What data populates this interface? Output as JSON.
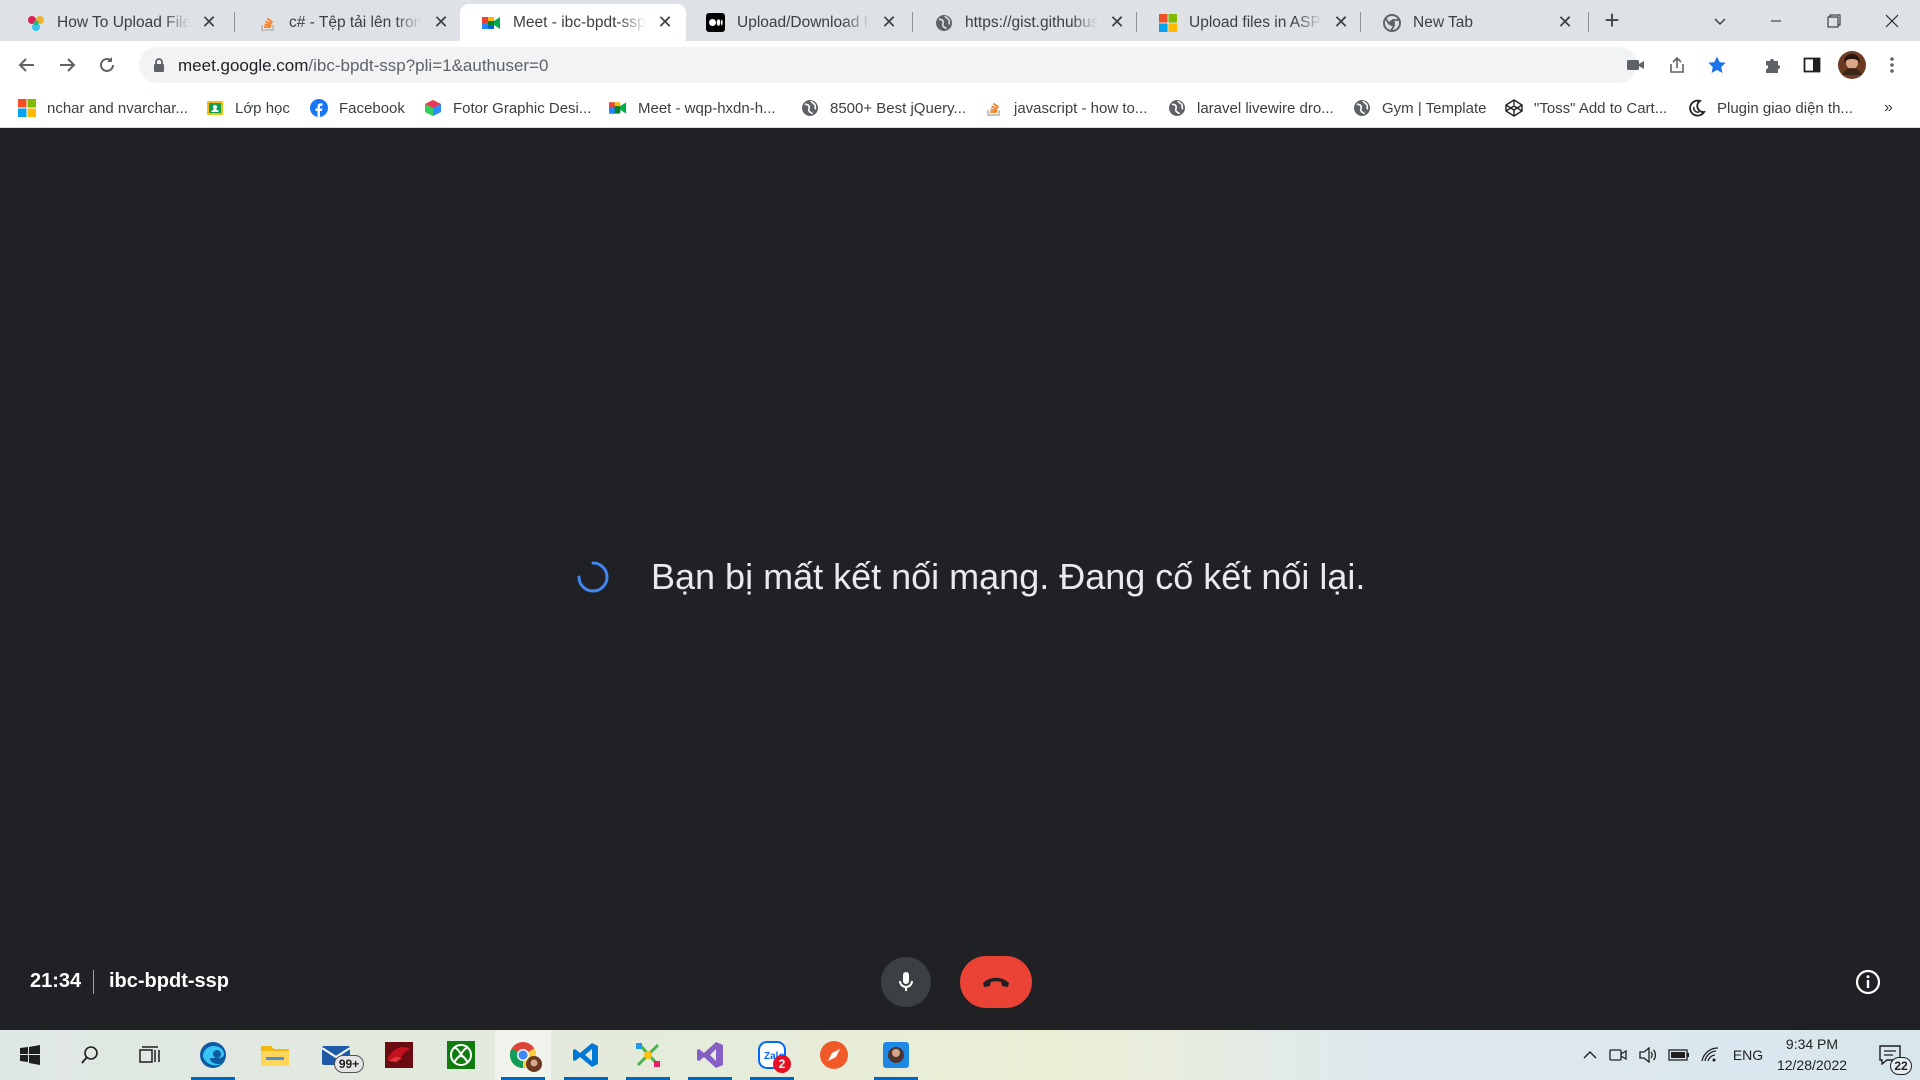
{
  "tabs": [
    {
      "title": "How To Upload Files With ASP.NET",
      "favicon": "slack-like-icon",
      "active": false
    },
    {
      "title": "c# - Tệp tải lên trong ASP.NET",
      "favicon": "stackoverflow-icon",
      "active": false
    },
    {
      "title": "Meet - ibc-bpdt-ssp",
      "favicon": "google-meet-icon",
      "active": true
    },
    {
      "title": "Upload/Download files",
      "favicon": "medium-icon",
      "active": false
    },
    {
      "title": "https://gist.githubusercontent.com",
      "favicon": "globe-icon",
      "active": false
    },
    {
      "title": "Upload files in ASP.NET Core",
      "favicon": "microsoft-icon",
      "active": false
    },
    {
      "title": "New Tab",
      "favicon": "chrome-icon",
      "active": false
    }
  ],
  "toolbar": {
    "url_host": "meet.google.com",
    "url_path": "/ibc-bpdt-ssp?pli=1&authuser=0"
  },
  "bookmarks": [
    {
      "label": "nchar and nvarchar...",
      "icon": "microsoft-icon"
    },
    {
      "label": "Lớp học",
      "icon": "google-classroom-icon"
    },
    {
      "label": "Facebook",
      "icon": "facebook-icon"
    },
    {
      "label": "Fotor Graphic Desi...",
      "icon": "fotor-icon"
    },
    {
      "label": "Meet - wqp-hxdn-h...",
      "icon": "google-meet-icon"
    },
    {
      "label": "8500+ Best jQuery...",
      "icon": "globe-icon"
    },
    {
      "label": "javascript - how to...",
      "icon": "stackoverflow-icon"
    },
    {
      "label": "laravel livewire dro...",
      "icon": "globe-icon"
    },
    {
      "label": "Gym | Template",
      "icon": "globe-icon"
    },
    {
      "label": "\"Toss\" Add to Cart...",
      "icon": "codepen-icon"
    },
    {
      "label": "Plugin giao diện th...",
      "icon": "moon-icon"
    }
  ],
  "meet": {
    "reconnect_message": "Bạn bị mất kết nối mạng. Đang cố kết nối lại.",
    "time": "21:34",
    "meeting_code": "ibc-bpdt-ssp"
  },
  "taskbar": {
    "mail_badge": "99+",
    "zalo_badge": "2",
    "language": "ENG",
    "clock_time": "9:34 PM",
    "clock_date": "12/28/2022",
    "notification_count": "22"
  },
  "colors": {
    "meet_background": "#202124",
    "leave_red": "#ea4335",
    "spinner_blue": "#4285f4",
    "bookmark_star": "#1a73e8"
  }
}
